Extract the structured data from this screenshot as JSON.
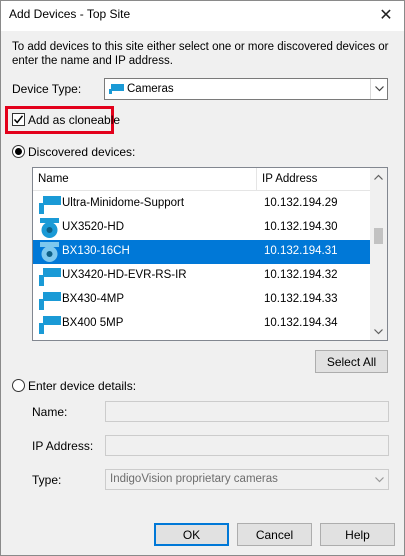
{
  "window": {
    "title": "Add Devices - Top Site",
    "close_glyph": "✕"
  },
  "intro_text": "To add devices to this site either select one or more discovered devices or enter the name and IP address.",
  "device_type": {
    "label": "Device Type:",
    "value": "Cameras",
    "icon": "camera-icon"
  },
  "cloneable": {
    "label": "Add as cloneable",
    "checked": true
  },
  "discovered": {
    "label": "Discovered devices:",
    "selected": true,
    "columns": [
      "Name",
      "IP Address"
    ],
    "rows": [
      {
        "name": "Ultra-Minidome-Support",
        "ip": "10.132.194.29",
        "icon": "box-camera-icon",
        "selected": false
      },
      {
        "name": "UX3520-HD",
        "ip": "10.132.194.30",
        "icon": "dome-camera-icon",
        "selected": false
      },
      {
        "name": "BX130-16CH",
        "ip": "10.132.194.31",
        "icon": "dome-camera-icon",
        "selected": true
      },
      {
        "name": "UX3420-HD-EVR-RS-IR",
        "ip": "10.132.194.32",
        "icon": "box-camera-icon",
        "selected": false
      },
      {
        "name": "BX430-4MP",
        "ip": "10.132.194.33",
        "icon": "box-camera-icon",
        "selected": false
      },
      {
        "name": "BX400 5MP",
        "ip": "10.132.194.34",
        "icon": "box-camera-icon",
        "selected": false
      }
    ],
    "select_all_label": "Select All"
  },
  "manual": {
    "label": "Enter device details:",
    "selected": false,
    "name_label": "Name:",
    "ip_label": "IP Address:",
    "type_label": "Type:",
    "type_value": "IndigoVision proprietary cameras"
  },
  "buttons": {
    "ok": "OK",
    "cancel": "Cancel",
    "help": "Help"
  },
  "colors": {
    "accent": "#0078d7",
    "highlight_box": "#e3001b",
    "camera_blue": "#1a9ad6"
  }
}
